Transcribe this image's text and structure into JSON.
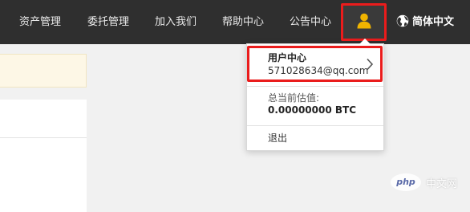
{
  "nav": {
    "items": [
      "资产管理",
      "委托管理",
      "加入我们",
      "帮助中心",
      "公告中心"
    ],
    "language": "简体中文",
    "user_icon": "user-icon",
    "globe_icon": "globe-icon"
  },
  "dropdown": {
    "user_center_label": "用户中心",
    "email": "571028634@qq.com",
    "asset_label": "总当前估值:",
    "asset_value": "0.00000000 BTC",
    "logout_label": "退出"
  },
  "watermark": {
    "badge": "php",
    "text": "中文网"
  },
  "colors": {
    "topbar": "#2f2f2f",
    "highlight": "#ea1c1c",
    "user_icon": "#f0b400",
    "notice_bg": "#fdf7e6"
  }
}
